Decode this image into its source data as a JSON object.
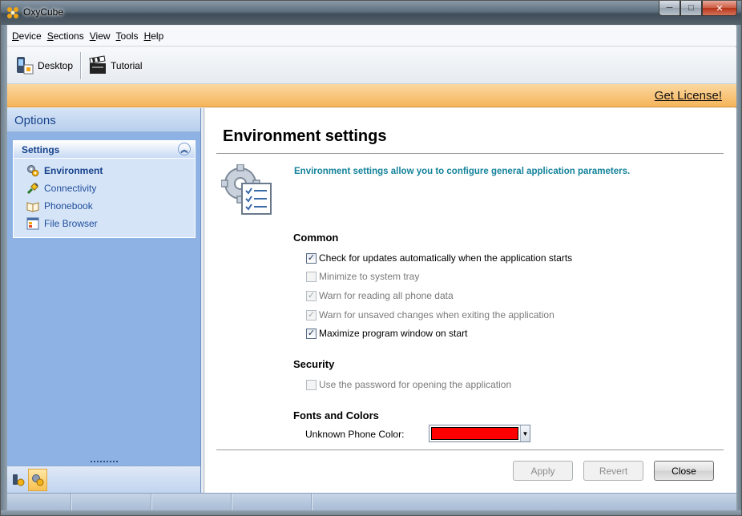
{
  "window": {
    "title": "OxyCube",
    "icon": "oxycube-app-icon",
    "controls": {
      "minimize": "─",
      "maximize": "□",
      "close": "✕"
    }
  },
  "menu": [
    "Device",
    "Sections",
    "View",
    "Tools",
    "Help"
  ],
  "toolbar": {
    "desktop_label": "Desktop",
    "tutorial_label": "Tutorial"
  },
  "license": {
    "link_label": "Get License!"
  },
  "sidebar": {
    "header": "Options",
    "group_title": "Settings",
    "collapse_glyph": "︽",
    "items": [
      {
        "label": "Environment",
        "icon": "gears-icon",
        "active": true
      },
      {
        "label": "Connectivity",
        "icon": "connectivity-icon",
        "active": false
      },
      {
        "label": "Phonebook",
        "icon": "phonebook-icon",
        "active": false
      },
      {
        "label": "File Browser",
        "icon": "file-browser-icon",
        "active": false
      }
    ]
  },
  "content": {
    "title": "Environment settings",
    "description": "Environment settings allow you to configure general application parameters.",
    "sections": {
      "common": {
        "title": "Common",
        "options": [
          {
            "label": "Check for updates automatically when the application starts",
            "checked": true,
            "enabled": true
          },
          {
            "label": "Minimize to system tray",
            "checked": false,
            "enabled": false
          },
          {
            "label": "Warn for reading all phone data",
            "checked": true,
            "enabled": false
          },
          {
            "label": "Warn for unsaved changes when exiting the application",
            "checked": true,
            "enabled": false
          },
          {
            "label": "Maximize program window on start",
            "checked": true,
            "enabled": true
          }
        ]
      },
      "security": {
        "title": "Security",
        "options": [
          {
            "label": "Use the password for opening the application",
            "checked": false,
            "enabled": false
          }
        ]
      },
      "fonts": {
        "title": "Fonts and Colors",
        "color_label": "Unknown Phone Color:",
        "color_value": "#ff0000"
      }
    },
    "buttons": {
      "apply": "Apply",
      "revert": "Revert",
      "close": "Close"
    }
  },
  "colors": {
    "accent": "#14839a",
    "license_bar": "#f5b45a",
    "sidebar": "#8db2e3"
  }
}
